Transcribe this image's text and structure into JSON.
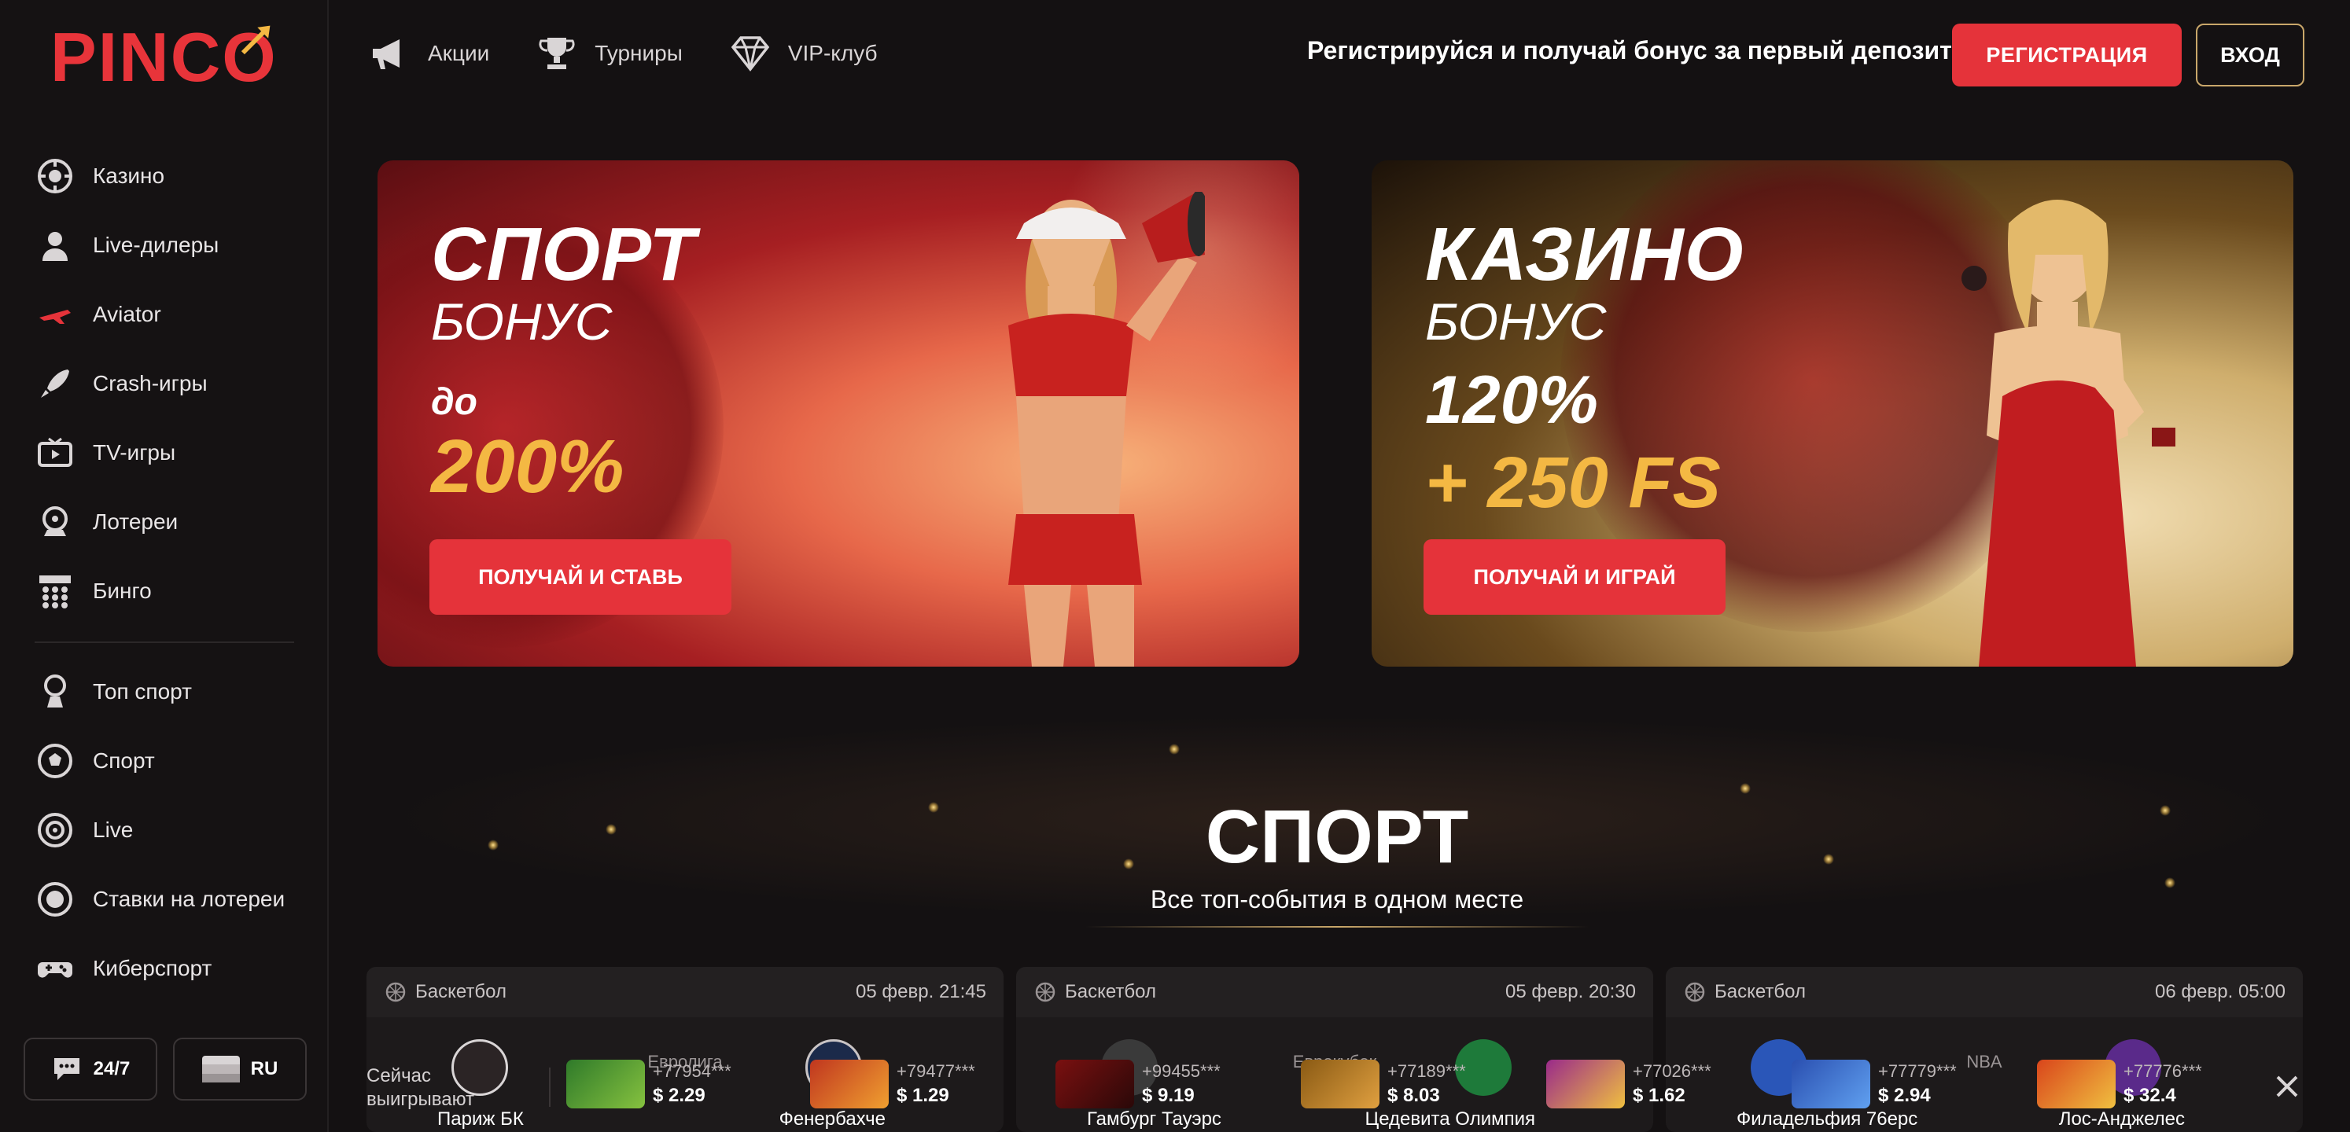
{
  "brand": {
    "logo_text": "PINCO",
    "accent": "#e5333a",
    "gold": "#c9a76a"
  },
  "sidebar": {
    "items": [
      {
        "label": "Казино",
        "icon": "casino-chip-icon"
      },
      {
        "label": "Live-дилеры",
        "icon": "dealer-icon"
      },
      {
        "label": "Aviator",
        "icon": "airplane-icon"
      },
      {
        "label": "Crash-игры",
        "icon": "rocket-icon"
      },
      {
        "label": "TV-игры",
        "icon": "tv-icon"
      },
      {
        "label": "Лотереи",
        "icon": "lottery-icon"
      },
      {
        "label": "Бинго",
        "icon": "bingo-icon"
      }
    ],
    "sport_items": [
      {
        "label": "Топ спорт",
        "icon": "trophy-ball-icon"
      },
      {
        "label": "Спорт",
        "icon": "soccer-ball-icon"
      },
      {
        "label": "Live",
        "icon": "live-target-icon"
      },
      {
        "label": "Ставки на лотереи",
        "icon": "lottery-ball-icon"
      },
      {
        "label": "Киберспорт",
        "icon": "gamepad-icon"
      }
    ],
    "support_label": "24/7",
    "lang_label": "RU"
  },
  "header": {
    "nav": [
      {
        "label": "Акции",
        "icon": "megaphone-icon"
      },
      {
        "label": "Турниры",
        "icon": "cup-icon"
      },
      {
        "label": "VIP-клуб",
        "icon": "diamond-icon"
      }
    ],
    "promo_text": "Регистрируйся и получай бонус за первый депозит",
    "register_label": "РЕГИСТРАЦИЯ",
    "login_label": "ВХОД"
  },
  "banners": {
    "sport": {
      "title": "СПОРТ",
      "subtitle": "БОНУС",
      "prefix": "до",
      "amount": "200%",
      "button": "ПОЛУЧАЙ И СТАВЬ"
    },
    "casino": {
      "title": "КАЗИНО",
      "subtitle": "БОНУС",
      "amount": "120%",
      "extra": "+ 250 FS",
      "button": "ПОЛУЧАЙ И ИГРАЙ"
    }
  },
  "sport_section": {
    "title": "СПОРТ",
    "subtitle": "Все топ-события в одном месте",
    "matches": [
      {
        "sport": "Баскетбол",
        "date": "05 февр. 21:45",
        "league": "Евролига",
        "team_a": "Париж БК",
        "team_b": "Фенербахче"
      },
      {
        "sport": "Баскетбол",
        "date": "05 февр. 20:30",
        "league": "Еврокубок",
        "team_a": "Гамбург Тауэрс",
        "team_b": "Цедевита Олимпия"
      },
      {
        "sport": "Баскетбол",
        "date": "06 февр. 05:00",
        "league": "NBA",
        "team_a": "Филадельфия 76ерс",
        "team_b": "Лос-Анджелес"
      }
    ]
  },
  "ticker": {
    "label": "Сейчас выигрывают",
    "wins": [
      {
        "id": "+77954***",
        "amount": "$ 2.29",
        "color": "#2f7a2a"
      },
      {
        "id": "+79477***",
        "amount": "$ 1.29",
        "color": "#c0361f"
      },
      {
        "id": "+99455***",
        "amount": "$ 9.19",
        "color": "#7a1010"
      },
      {
        "id": "+77189***",
        "amount": "$ 8.03",
        "color": "#8a5a14"
      },
      {
        "id": "+77026***",
        "amount": "$ 1.62",
        "color": "#9a2a8a"
      },
      {
        "id": "+77779***",
        "amount": "$ 2.94",
        "color": "#2a4fb0"
      },
      {
        "id": "+77776***",
        "amount": "$ 32.4",
        "color": "#d9451b"
      }
    ]
  }
}
